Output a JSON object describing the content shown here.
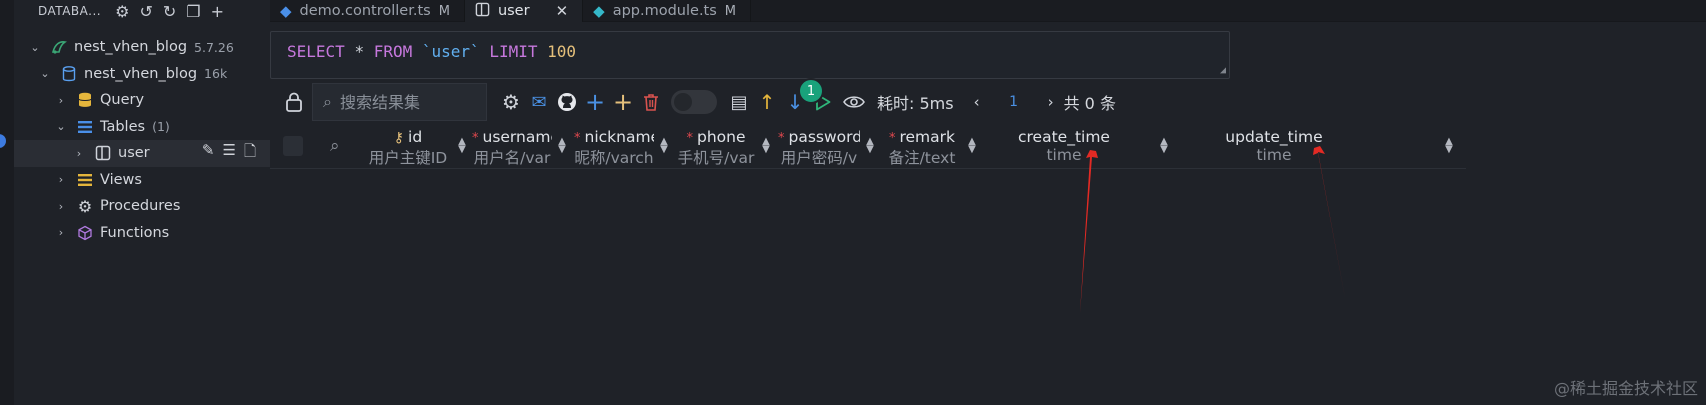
{
  "sidebar": {
    "header_title": "DATABA...",
    "tree": {
      "connection": {
        "label": "nest_vhen_blog",
        "meta": "5.7.26"
      },
      "database": {
        "label": "nest_vhen_blog",
        "meta": "16k"
      },
      "query": {
        "label": "Query"
      },
      "tables": {
        "label": "Tables",
        "meta": "(1)"
      },
      "table_user": {
        "label": "user"
      },
      "views": {
        "label": "Views"
      },
      "procedures": {
        "label": "Procedures"
      },
      "functions": {
        "label": "Functions"
      }
    }
  },
  "tabs": [
    {
      "label": "demo.controller.ts",
      "mod": "M"
    },
    {
      "label": "user",
      "mod": ""
    },
    {
      "label": "app.module.ts",
      "mod": "M"
    }
  ],
  "editor": {
    "kw_select": "SELECT",
    "star": "*",
    "kw_from": "FROM",
    "table": "`user`",
    "kw_limit": "LIMIT",
    "limit": "100"
  },
  "toolbar": {
    "search_placeholder": "搜索结果集",
    "badge_count": "1",
    "timing": "耗时: 5ms",
    "page": "1",
    "total": "共 0 条"
  },
  "columns": [
    {
      "name": "id",
      "type": "用户主键ID",
      "required": false,
      "key": true
    },
    {
      "name": "username",
      "type": "用户名/var",
      "required": true,
      "key": false
    },
    {
      "name": "nickname",
      "type": "昵称/varch",
      "required": true,
      "key": false
    },
    {
      "name": "phone",
      "type": "手机号/var",
      "required": true,
      "key": false
    },
    {
      "name": "password",
      "type": "用户密码/v",
      "required": true,
      "key": false
    },
    {
      "name": "remark",
      "type": "备注/text",
      "required": true,
      "key": false
    },
    {
      "name": "create_time",
      "type": "time",
      "required": false,
      "key": false
    },
    {
      "name": "update_time",
      "type": "time",
      "required": false,
      "key": false
    }
  ],
  "watermark": "@稀土掘金技术社区",
  "colors": {
    "accent": "#4a90e2",
    "badge": "#19a27b",
    "required": "#e0484e",
    "annotation_arrow": "#e32a24"
  }
}
